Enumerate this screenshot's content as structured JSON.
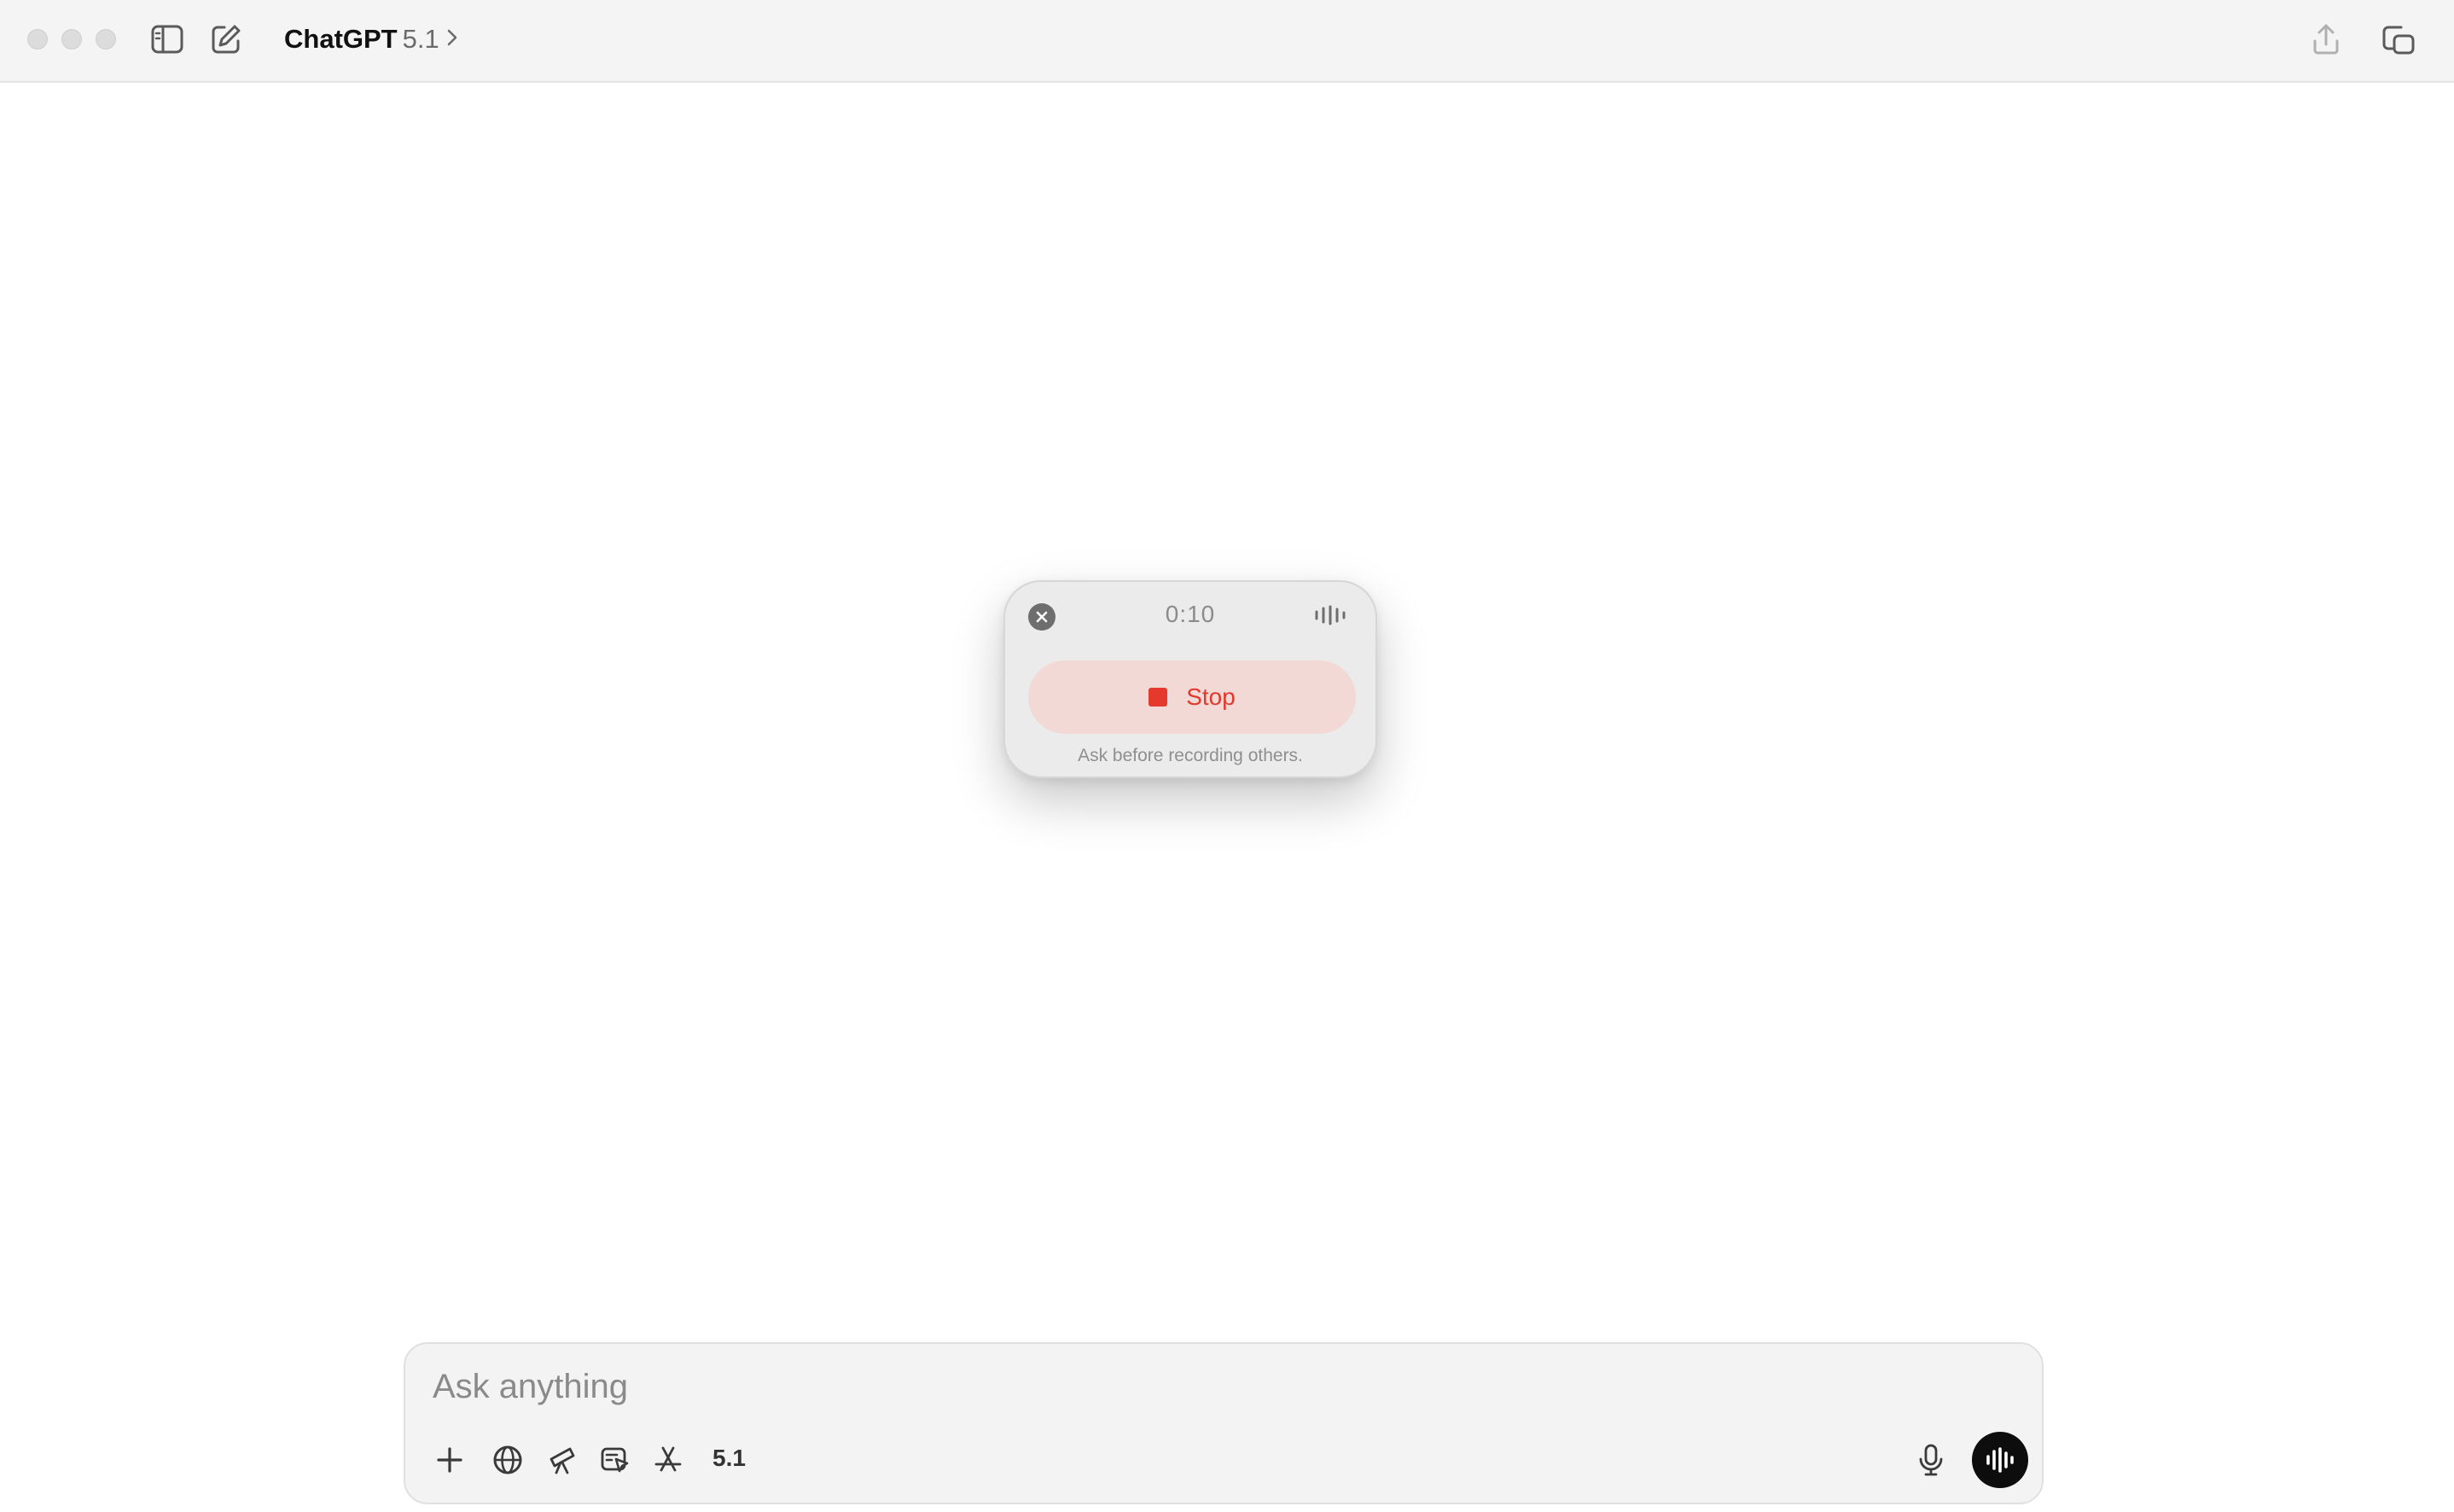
{
  "window": {
    "app_name": "ChatGPT",
    "model_version": "5.1",
    "icons": [
      "sidebar-toggle-icon",
      "new-chat-icon",
      "chevron-right-icon",
      "share-icon",
      "new-window-icon"
    ]
  },
  "recording": {
    "timer": "0:10",
    "stop_label": "Stop",
    "note": "Ask before recording others.",
    "stop_color": "#e5392e"
  },
  "composer": {
    "placeholder": "Ask anything",
    "model_chip": "5.1",
    "tools": [
      "plus-icon",
      "globe-icon",
      "telescope-icon",
      "canvas-icon",
      "app-store-icon"
    ]
  }
}
